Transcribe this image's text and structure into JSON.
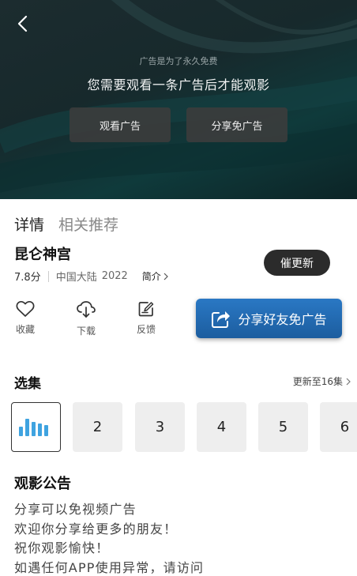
{
  "ad": {
    "note": "广告是为了永久免费",
    "message": "您需要观看一条广告后才能观影",
    "watch_label": "观看广告",
    "share_label": "分享免广告"
  },
  "tabs": [
    {
      "label": "详情",
      "active": true
    },
    {
      "label": "相关推荐",
      "active": false
    }
  ],
  "video": {
    "title": "昆仑神宫",
    "score": "7.8分",
    "region": "中国大陆",
    "year": "2022",
    "intro_label": "简介",
    "urge_label": "催更新"
  },
  "actions": [
    {
      "label": "收藏",
      "icon": "heart-icon"
    },
    {
      "label": "下载",
      "icon": "cloud-download-icon"
    },
    {
      "label": "反馈",
      "icon": "edit-icon"
    }
  ],
  "share_friends_label": "分享好友免广告",
  "episodes": {
    "title": "选集",
    "update_label": "更新至16集",
    "items": [
      "",
      "2",
      "3",
      "4",
      "5",
      "6"
    ],
    "current_index": 0
  },
  "notice": {
    "title": "观影公告",
    "lines": [
      "分享可以免视频广告",
      "欢迎你分享给更多的朋友！",
      "祝你观影愉快！",
      "如遇任何APP使用异常，请访问"
    ]
  }
}
